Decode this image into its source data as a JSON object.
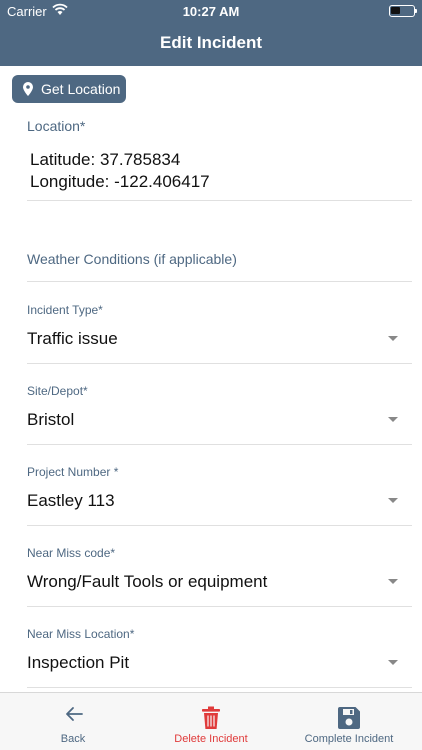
{
  "status_bar": {
    "carrier": "Carrier",
    "time": "10:27 AM"
  },
  "nav": {
    "title": "Edit Incident"
  },
  "get_location_label": "Get Location",
  "location": {
    "label": "Location*",
    "latitude_line": "Latitude: 37.785834",
    "longitude_line": "Longitude: -122.406417"
  },
  "weather": {
    "placeholder": "Weather Conditions (if applicable)"
  },
  "fields": [
    {
      "label": "Incident Type*",
      "value": "Traffic issue"
    },
    {
      "label": "Site/Depot*",
      "value": "Bristol"
    },
    {
      "label": "Project Number *",
      "value": "Eastley 113"
    },
    {
      "label": "Near Miss code*",
      "value": "Wrong/Fault Tools or equipment"
    },
    {
      "label": "Near Miss Location*",
      "value": "Inspection Pit"
    }
  ],
  "tabs": {
    "back": "Back",
    "delete": "Delete Incident",
    "complete": "Complete Incident"
  },
  "colors": {
    "header": "#4e6882",
    "label": "#4e6882",
    "delete": "#e03b3b",
    "tab_text": "#4e6882"
  },
  "icons": [
    "wifi-icon",
    "battery-icon",
    "location-pin-icon",
    "chevron-down-icon",
    "back-arrow-icon",
    "trash-icon",
    "save-icon"
  ]
}
